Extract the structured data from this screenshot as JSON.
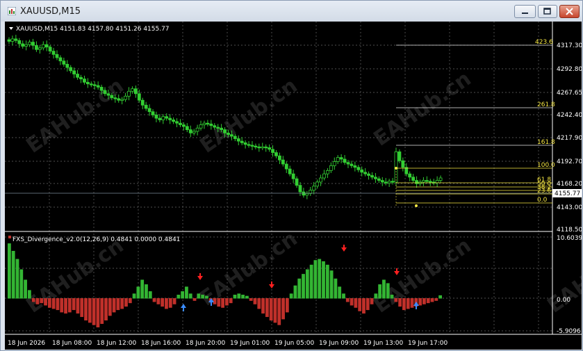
{
  "window": {
    "title": "XAUUSD,M15"
  },
  "price_panel": {
    "header": "XAUUSD,M15  4151.83 4157.80 4151.26 4155.77",
    "current_price": "4155.77",
    "price_axis": [
      "4317.30",
      "4292.80",
      "4267.65",
      "4242.40",
      "4217.90",
      "4192.70",
      "4168.20",
      "4143.00",
      "4118.50"
    ],
    "fibo_levels": [
      "423.6",
      "261.8",
      "161.8",
      "100.0",
      "61.8",
      "50.0",
      "38.2",
      "23.6",
      "0.0"
    ]
  },
  "indicator_panel": {
    "header": "FXS_Divergence_v2.0(12,26,9) 0.4841 0.0000 0.4841",
    "axis": [
      "10.6039",
      "0.00",
      "-5.9096"
    ]
  },
  "time_axis": [
    "18 Jun 2026",
    "18 Jun 08:00",
    "18 Jun 12:00",
    "18 Jun 16:00",
    "18 Jun 20:00",
    "19 Jun 01:00",
    "19 Jun 05:00",
    "19 Jun 09:00",
    "19 Jun 13:00",
    "19 Jun 17:00"
  ],
  "watermark": "EAHub.cn",
  "colors": {
    "candle": "#32cd32",
    "hist_up": "#33b533",
    "hist_down": "#c0302a",
    "fibo": "#f5e642",
    "grid": "#6a6a6a",
    "arrow_up": "#3a8cff",
    "arrow_down": "#ff2020"
  },
  "chart_data": {
    "type": "candlestick",
    "title": "XAUUSD,M15",
    "ylim": [
      4118.5,
      4317.3
    ],
    "closes": [
      4322,
      4325,
      4323,
      4319,
      4316,
      4318,
      4321,
      4317,
      4312,
      4314,
      4318,
      4315,
      4310,
      4306,
      4302,
      4298,
      4294,
      4290,
      4286,
      4282,
      4278,
      4276,
      4272,
      4270,
      4269,
      4268,
      4266,
      4262,
      4258,
      4256,
      4253,
      4252,
      4250,
      4251,
      4255,
      4261,
      4264,
      4258,
      4250,
      4244,
      4240,
      4236,
      4232,
      4228,
      4226,
      4230,
      4228,
      4226,
      4224,
      4222,
      4220,
      4218,
      4214,
      4210,
      4212,
      4216,
      4220,
      4222,
      4221,
      4219,
      4217,
      4216,
      4214,
      4210,
      4208,
      4206,
      4203,
      4200,
      4198,
      4196,
      4195,
      4194,
      4193,
      4192,
      4193,
      4192,
      4190,
      4186,
      4182,
      4177,
      4172,
      4166,
      4160,
      4154,
      4146,
      4138,
      4134,
      4136,
      4140,
      4145,
      4150,
      4155,
      4160,
      4164,
      4170,
      4175,
      4180,
      4178,
      4174,
      4172,
      4170,
      4168,
      4165,
      4162,
      4160,
      4158,
      4156,
      4154,
      4152,
      4150,
      4149,
      4151,
      4150,
      4187,
      4176,
      4168,
      4160,
      4156,
      4152,
      4148,
      4150,
      4152,
      4151,
      4150,
      4149,
      4152,
      4155
    ],
    "histogram": [
      9.5,
      8.2,
      6.8,
      5.0,
      3.2,
      1.4,
      -0.6,
      -1.0,
      -0.8,
      -1.2,
      -1.6,
      -1.8,
      -2.0,
      -2.4,
      -2.6,
      -2.4,
      -2.0,
      -2.6,
      -3.2,
      -3.8,
      -4.2,
      -4.6,
      -5.0,
      -4.4,
      -3.8,
      -3.0,
      -2.4,
      -2.0,
      -1.8,
      -1.4,
      -0.8,
      0.8,
      2.0,
      3.2,
      2.4,
      1.2,
      -0.6,
      -1.0,
      -1.4,
      -1.8,
      -1.6,
      -1.0,
      0.6,
      1.2,
      2.0,
      0.8,
      -0.4,
      0.8,
      0.6,
      0.4,
      -0.6,
      -1.0,
      -1.4,
      -1.6,
      -1.2,
      -0.8,
      0.6,
      0.8,
      0.6,
      0.4,
      -0.4,
      -1.0,
      -1.8,
      -2.6,
      -3.2,
      -3.8,
      -4.2,
      -4.6,
      -3.6,
      -2.4,
      0.8,
      2.2,
      3.4,
      4.2,
      5.0,
      5.8,
      6.6,
      6.8,
      6.4,
      5.8,
      4.8,
      3.4,
      2.0,
      0.8,
      -0.6,
      -1.2,
      -1.6,
      -2.2,
      -2.6,
      -2.0,
      -1.0,
      0.8,
      2.4,
      3.2,
      2.6,
      0.6,
      -0.6,
      -1.4,
      -2.0,
      -1.8,
      -1.6,
      -1.4,
      -1.2,
      -1.0,
      -0.8,
      -0.6,
      -0.4,
      0.5
    ],
    "indicator_ylim": [
      -5.9096,
      10.6039
    ]
  }
}
